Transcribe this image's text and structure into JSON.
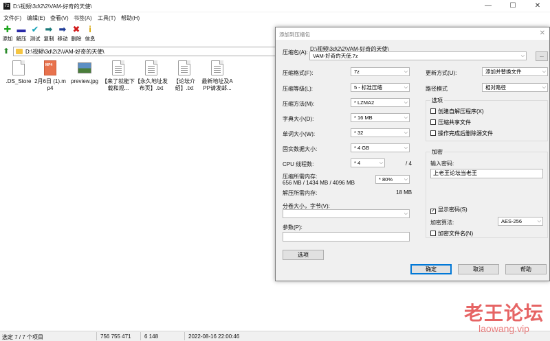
{
  "window": {
    "app_icon": "7z",
    "title": "D:\\视频\\3d\\2\\2\\VAM-好奇的天使\\"
  },
  "menu": [
    "文件(F)",
    "编辑(E)",
    "查看(V)",
    "书签(A)",
    "工具(T)",
    "帮助(H)"
  ],
  "toolbar": [
    {
      "label": "添加",
      "icon": "add-icon",
      "glyph": "✚",
      "color": "#1fa51f"
    },
    {
      "label": "解压",
      "icon": "extract-icon",
      "glyph": "▬",
      "color": "#2a2aa8"
    },
    {
      "label": "测试",
      "icon": "test-icon",
      "glyph": "✔",
      "color": "#16a3b8"
    },
    {
      "label": "复制",
      "icon": "copy-icon",
      "glyph": "➡",
      "color": "#1c7a7a"
    },
    {
      "label": "移动",
      "icon": "move-icon",
      "glyph": "➡",
      "color": "#1e3c96"
    },
    {
      "label": "删除",
      "icon": "delete-icon",
      "glyph": "✖",
      "color": "#d01a1a"
    },
    {
      "label": "信息",
      "icon": "info-icon",
      "glyph": "i",
      "color": "#d6a400"
    }
  ],
  "path": "D:\\视频\\3d\\2\\2\\VAM-好奇的天使\\",
  "files": [
    {
      "name": ".DS_Store",
      "type": "doc"
    },
    {
      "name": "2月6日 (1).mp4",
      "type": "mp4"
    },
    {
      "name": "preview.jpg",
      "type": "jpg"
    },
    {
      "name": "【来了就能下载和观...",
      "type": "txt"
    },
    {
      "name": "【永久地址发布页】.txt",
      "type": "txt"
    },
    {
      "name": "【论坛介绍】.txt",
      "type": "txt"
    },
    {
      "name": "最新地址及APP请发邮...",
      "type": "txt"
    }
  ],
  "status": {
    "selected": "选定 7 / 7 个项目",
    "size": "756 755 471",
    "packed": "6 148",
    "modified": "2022-08-16 22:00:46"
  },
  "dialog": {
    "title": "添加到压缩包",
    "archive_label": "压缩包(A):",
    "archive_dir": "D:\\视频\\3d\\2\\2\\VAM-好奇的天使\\",
    "archive_name": "VAM-好奇的天使.7z",
    "browse": "...",
    "format_label": "压缩格式(F):",
    "format": "7z",
    "level_label": "压缩等级(L):",
    "level": "5 - 标准压缩",
    "method_label": "压缩方法(M):",
    "method": "* LZMA2",
    "dict_label": "字典大小(D):",
    "dict": "* 16 MB",
    "word_label": "单词大小(W):",
    "word": "* 32",
    "solid_label": "固实数据大小:",
    "solid": "* 4 GB",
    "cpu_label": "CPU 线程数:",
    "cpu": "* 4",
    "cpu_max": "/ 4",
    "mem_label": "压缩所需内存:",
    "mem_values": "656 MB / 1434 MB / 4096 MB",
    "mem_pct": "* 80%",
    "dmem_label": "解压所需内存:",
    "dmem": "18 MB",
    "split_label": "分卷大小，字节(V):",
    "params_label": "参数(P):",
    "options_btn": "选项",
    "update_label": "更新方式(U):",
    "update": "添加并替换文件",
    "pathmode_label": "路径模式",
    "pathmode": "相对路径",
    "options_group": "选项",
    "opt_sfx": "创建自解压程序(X)",
    "opt_shared": "压缩共享文件",
    "opt_delete": "操作完成后删除源文件",
    "enc_group": "加密",
    "pwd_label": "输入密码:",
    "pwd": "上老王论坛当老王",
    "show_pwd": "显示密码(S)",
    "enc_method_label": "加密算法:",
    "enc_method": "AES-256",
    "enc_names": "加密文件名(N)",
    "ok": "确定",
    "cancel": "取消",
    "help": "帮助"
  },
  "watermark": {
    "cn": "老王论坛",
    "en": "laowang.vip"
  }
}
